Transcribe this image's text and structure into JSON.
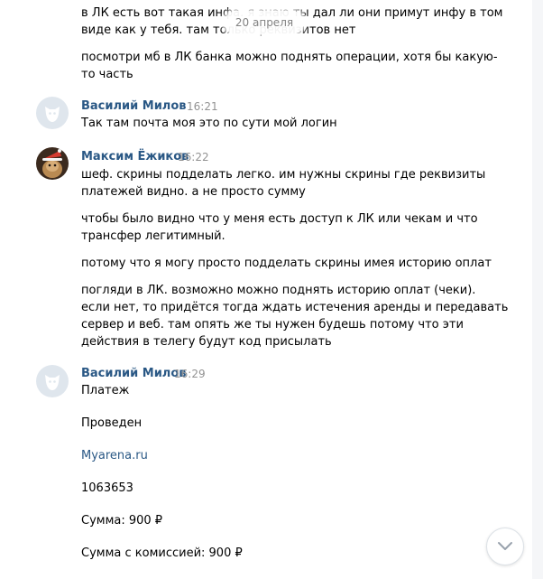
{
  "date_badge": "20 апреля",
  "colors": {
    "name": "#2a5885",
    "time": "#939393",
    "link": "#2a5885"
  },
  "messages": [
    {
      "lines": [
        "в ЛК есть вот такая инфа. я знаю ты дал ли они примут инфу в том",
        "виде как у тебя. там только реквизитов нет"
      ]
    },
    {
      "lines": [
        "посмотри мб в ЛК банка можно поднять операции, хотя бы какую-",
        "то часть"
      ]
    },
    {
      "author": "Василий Милов",
      "time": "16:21",
      "avatar": "default-avatar",
      "lines": [
        "Так там почта моя это по сути мой логин"
      ]
    },
    {
      "author": "Максим Ёжиков",
      "time": "16:22",
      "avatar": "user-photo",
      "paragraphs": [
        [
          "шеф. скрины подделать легко. им нужны скрины где реквизиты",
          "платежей видно. а не просто сумму"
        ],
        [
          "чтобы было видно что у меня есть доступ к ЛК или чекам и что",
          "трансфер легитимный."
        ],
        [
          "потому что я могу просто подделать скрины имея историю оплат"
        ],
        [
          "погляди в ЛК. возможно можно поднять историю оплат (чеки).",
          "если нет, то придётся тогда ждать истечения аренды и передавать",
          "сервер и веб. там опять же ты нужен будешь потому что эти",
          "действия в телегу будут код присылать"
        ]
      ]
    },
    {
      "author": "Василий Милов",
      "time": "16:29",
      "avatar": "default-avatar",
      "items": [
        "Платеж",
        "Проведен",
        "Myarena.ru",
        "1063653",
        "Сумма: 900 ₽",
        "Сумма с комиссией: 900 ₽"
      ]
    }
  ],
  "scroll_down_icon": "chevron-down-icon"
}
